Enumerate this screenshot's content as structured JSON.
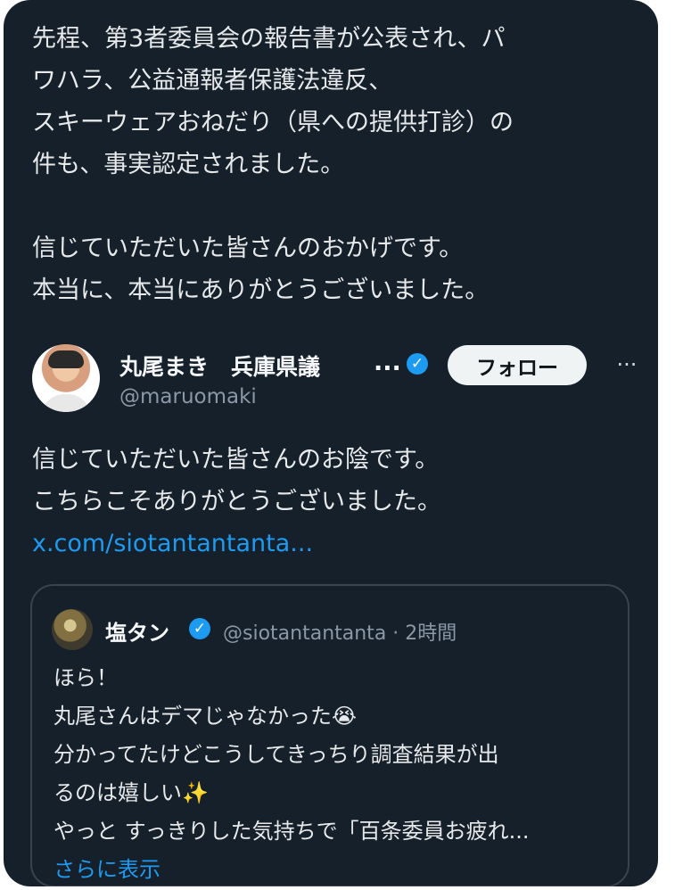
{
  "quoted_tweet_text": [
    "先程、第3者委員会の報告書が公表され、パ",
    "ワハラ、公益通報者保護法違反、",
    "スキーウェアおねだり（県への提供打診）の",
    "件も、事実認定されました。",
    "",
    "信じていただいた皆さんのおかげです。",
    "本当に、本当にありがとうございました。"
  ],
  "author": {
    "name": "丸尾まき　兵庫県議",
    "ellipsis": "...",
    "handle": "@maruomaki",
    "verified_icon": "✓"
  },
  "actions": {
    "follow": "フォロー",
    "more": "···"
  },
  "reply_text": [
    "信じていただいた皆さんのお陰です。",
    "こちらこそありがとうございました。"
  ],
  "reply_link": "x.com/siotantantanta...",
  "quote": {
    "name": "塩タン",
    "handle_time": "@siotantantanta · 2時間",
    "verified_icon": "✓",
    "body": [
      "ほら！",
      "丸尾さんはデマじゃなかった😭",
      "分かってたけどこうしてきっちり調査結果が出",
      "るのは嬉しい✨",
      "やっと すっきりした気持ちで「百条委員お疲れ..."
    ],
    "show_more": "さらに表示"
  },
  "colors": {
    "background": "#15202b",
    "text": "#e7e9ea",
    "muted": "#8b98a5",
    "link": "#1d9bf0",
    "border": "#38444d"
  },
  "icons": {
    "verified": "verified-badge-icon",
    "more": "more-options-icon",
    "author_avatar": "author-avatar",
    "quote_avatar": "quote-author-avatar"
  }
}
